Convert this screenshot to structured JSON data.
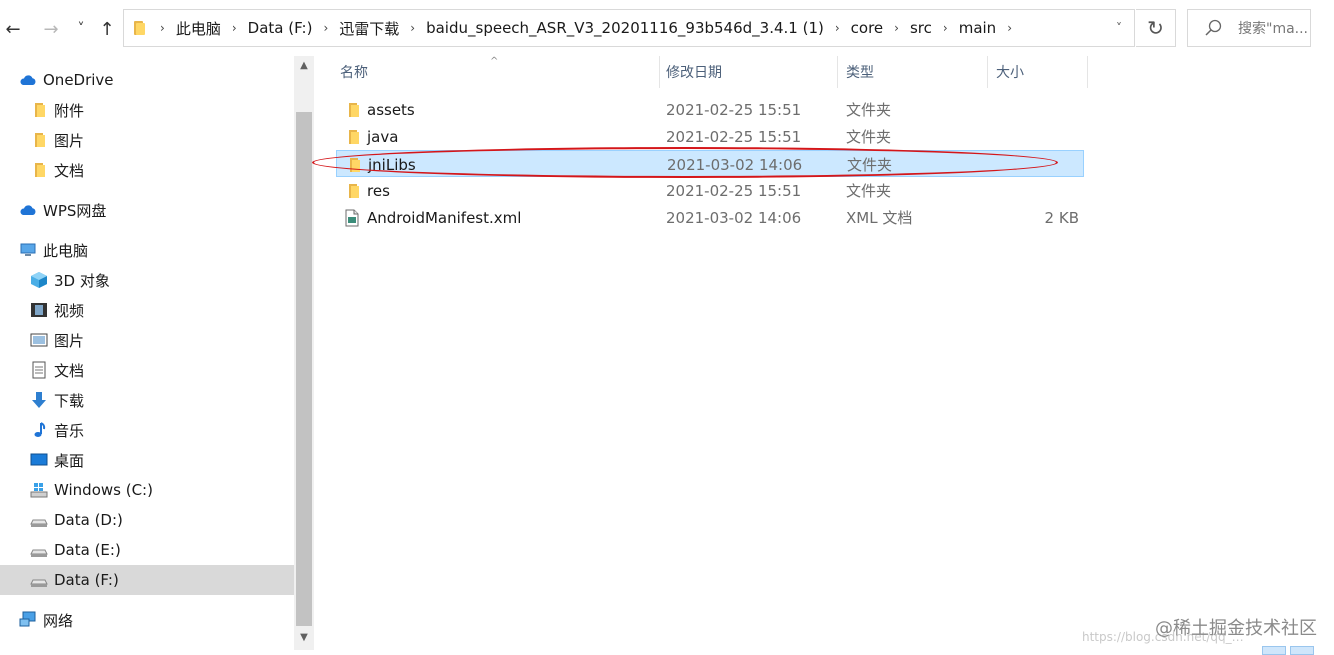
{
  "navigation": {
    "back_label": "←",
    "forward_label": "→",
    "recent_label": "˅",
    "up_label": "↑"
  },
  "address": {
    "crumbs": [
      "此电脑",
      "Data (F:)",
      "迅雷下载",
      "baidu_speech_ASR_V3_20201116_93b546d_3.4.1 (1)",
      "core",
      "src",
      "main"
    ],
    "separator": "›",
    "dropdown_label": "˅",
    "refresh_label": "↻"
  },
  "search": {
    "placeholder": "搜索\"ma..."
  },
  "sidebar": {
    "items": [
      {
        "label": "OneDrive",
        "icon": "cloud-icon"
      },
      {
        "label": "附件",
        "icon": "folder-icon"
      },
      {
        "label": "图片",
        "icon": "folder-icon"
      },
      {
        "label": "文档",
        "icon": "folder-icon"
      },
      {
        "label": "WPS网盘",
        "icon": "cloud-icon"
      },
      {
        "label": "此电脑",
        "icon": "computer-icon"
      },
      {
        "label": "3D 对象",
        "icon": "cube-icon"
      },
      {
        "label": "视频",
        "icon": "film-icon"
      },
      {
        "label": "图片",
        "icon": "picture-icon"
      },
      {
        "label": "文档",
        "icon": "document-icon"
      },
      {
        "label": "下载",
        "icon": "download-icon"
      },
      {
        "label": "音乐",
        "icon": "music-icon"
      },
      {
        "label": "桌面",
        "icon": "desktop-icon"
      },
      {
        "label": "Windows (C:)",
        "icon": "windows-drive-icon"
      },
      {
        "label": "Data (D:)",
        "icon": "drive-icon"
      },
      {
        "label": "Data (E:)",
        "icon": "drive-icon"
      },
      {
        "label": "Data (F:)",
        "icon": "drive-icon"
      },
      {
        "label": "网络",
        "icon": "network-icon"
      }
    ],
    "scroll_up": "▲",
    "scroll_down": "▼"
  },
  "columns": {
    "name": "名称",
    "date": "修改日期",
    "type": "类型",
    "size": "大小",
    "sort_indicator": "^"
  },
  "files": [
    {
      "name": "assets",
      "date": "2021-02-25 15:51",
      "type": "文件夹",
      "size": "",
      "icon": "folder-icon"
    },
    {
      "name": "java",
      "date": "2021-02-25 15:51",
      "type": "文件夹",
      "size": "",
      "icon": "folder-icon"
    },
    {
      "name": "jniLibs",
      "date": "2021-03-02 14:06",
      "type": "文件夹",
      "size": "",
      "icon": "folder-icon",
      "selected": true
    },
    {
      "name": "res",
      "date": "2021-02-25 15:51",
      "type": "文件夹",
      "size": "",
      "icon": "folder-icon"
    },
    {
      "name": "AndroidManifest.xml",
      "date": "2021-03-02 14:06",
      "type": "XML 文档",
      "size": "2 KB",
      "icon": "xml-file-icon"
    }
  ],
  "watermark": {
    "text": "@稀土掘金技术社区",
    "url_text": "https://blog.csdn.net/qq_…"
  },
  "colors": {
    "selection": "#cce8ff",
    "annotation": "#d4161a",
    "folder": "#ffd765"
  }
}
